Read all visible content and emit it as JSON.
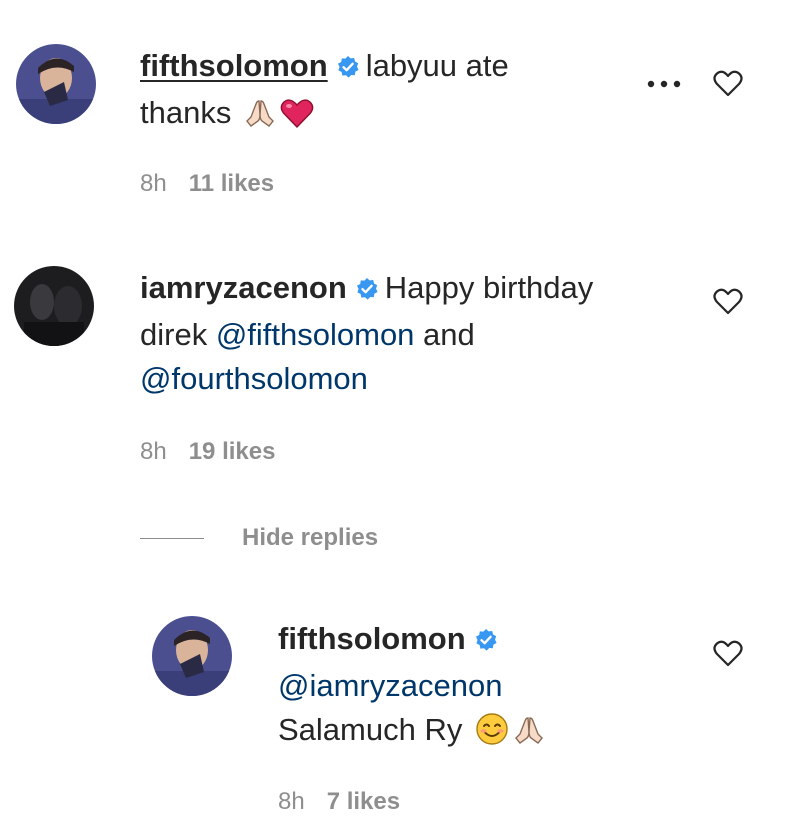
{
  "comments": [
    {
      "username": "fifthsolomon",
      "text_line1": "labyuu ate",
      "text_line2": "thanks",
      "time": "8h",
      "likes": "11 likes",
      "emojis": [
        "folded-hands",
        "red-heart"
      ]
    },
    {
      "username": "iamryzacenon",
      "text_line1": "Happy birthday",
      "text_line2_prefix": "direk ",
      "mention1": "@fifthsolomon",
      "text_line2_suffix": " and",
      "mention2": "@fourthsolomon",
      "time": "8h",
      "likes": "19 likes"
    }
  ],
  "hide_replies_label": "Hide replies",
  "reply": {
    "username": "fifthsolomon",
    "mention": "@iamryzacenon",
    "text": "Salamuch Ry",
    "time": "8h",
    "likes": "7 likes",
    "emojis": [
      "smiling-face",
      "folded-hands"
    ]
  },
  "colors": {
    "text": "#262626",
    "muted": "#8e8e8e",
    "mention": "#00376b",
    "verified": "#3897f0",
    "heart_emoji": "#e0245e"
  }
}
